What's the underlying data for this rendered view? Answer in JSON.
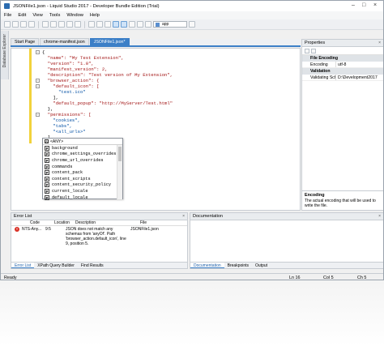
{
  "window": {
    "title": "JSONFile1.json - Liquid Studio 2017 - Developer Bundle Edition (Trial)"
  },
  "menu": [
    "File",
    "Edit",
    "View",
    "Tools",
    "Window",
    "Help"
  ],
  "toolbar": {
    "combo_value": "app"
  },
  "side_tab": "Database Explorer",
  "doc_tabs": [
    "Start Page",
    "chrome-manifest.json",
    "JSONFile1.json*"
  ],
  "code": [
    "{",
    "  \"name\": \"My Test Extension\",",
    "  \"version\": \"1.0\",",
    "  \"manifest_version\": 2,",
    "  \"description\": \"Test version of My Extension\",",
    "  \"browser_action\": {",
    "    \"default_icon\": [",
    "      \"test.ico\"",
    "    ],",
    "    \"default_popup\": \"http://MyServer/Test.html\"",
    "  },",
    "  \"permissions\": [",
    "    \"cookies\",",
    "    \"tabs\",",
    "    \"<all_urls>\"",
    "  ],"
  ],
  "autocomplete": {
    "header": "<ANY>",
    "items": [
      "background",
      "chrome_settings_overrides",
      "chrome_url_overrides",
      "commands",
      "content_pack",
      "content_scripts",
      "content_security_policy",
      "current_locale",
      "default_locale"
    ]
  },
  "properties": {
    "title": "Properties",
    "categories": [
      {
        "name": "File Encoding",
        "rows": [
          {
            "name": "Encoding",
            "value": "utf-8"
          }
        ]
      },
      {
        "name": "Validation",
        "rows": [
          {
            "name": "Validating Schem",
            "value": "D:\\Development2017"
          }
        ]
      }
    ],
    "desc_title": "Encoding",
    "desc_text": "The actual encoding that will be used to write the file."
  },
  "error_list": {
    "title": "Error List",
    "columns": [
      "Code",
      "Location",
      "Description",
      "File"
    ],
    "row": {
      "code": "NTS-Any...",
      "location": "9:5",
      "description": "JSON does not match any schemas from 'anyOf'. Path 'browser_action.default_icon', line 9, position 5.",
      "file": "JSONFile1.json"
    },
    "tabs": [
      "Error List",
      "XPath Query Builder",
      "Find Results"
    ]
  },
  "documentation": {
    "title": "Documentation",
    "tabs": [
      "Documentation",
      "Breakpoints",
      "Output"
    ]
  },
  "status": {
    "left": "Ready",
    "ln": "Ln 16",
    "col": "Col 5",
    "ch": "Ch 5"
  }
}
